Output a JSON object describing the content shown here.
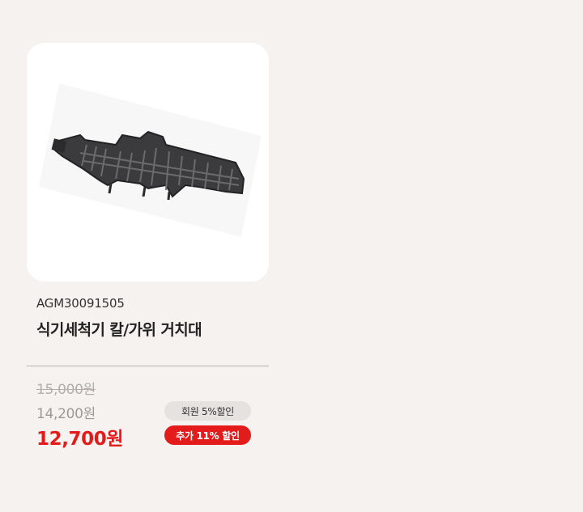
{
  "product": {
    "image_name": "dishwasher-knife-scissors-holder-image",
    "sku": "AGM30091505",
    "name": "식기세척기 칼/가위 거치대"
  },
  "prices": {
    "original": "15,000원",
    "member": "14,200원",
    "final": "12,700원"
  },
  "badges": {
    "member_discount": "회원 5%할인",
    "extra_discount": "추가 11% 할인"
  },
  "colors": {
    "background": "#f5f2f0",
    "accent": "#e41b1b",
    "member_badge": "#e5e2e0"
  }
}
